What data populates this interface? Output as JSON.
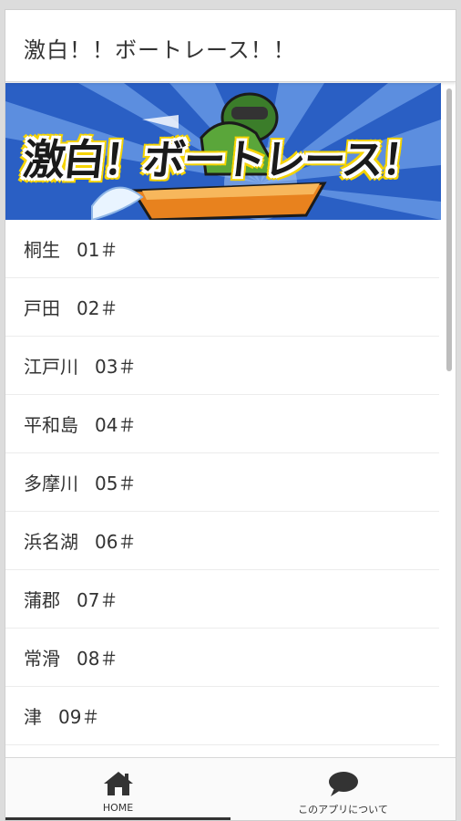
{
  "header": {
    "title": "激白！！ボートレース！！"
  },
  "banner": {
    "text": "激白！ボートレース！",
    "colors": {
      "sky": "#2a5fc4",
      "rays": "#6d9ee8",
      "outline": "#f5d300",
      "boat": "#e8821e"
    }
  },
  "venues": [
    {
      "name": "桐生",
      "code": "01＃"
    },
    {
      "name": "戸田",
      "code": "02＃"
    },
    {
      "name": "江戸川",
      "code": "03＃"
    },
    {
      "name": "平和島",
      "code": "04＃"
    },
    {
      "name": "多摩川",
      "code": "05＃"
    },
    {
      "name": "浜名湖",
      "code": "06＃"
    },
    {
      "name": "蒲郡",
      "code": "07＃"
    },
    {
      "name": "常滑",
      "code": "08＃"
    },
    {
      "name": "津",
      "code": "09＃"
    }
  ],
  "bottom_nav": {
    "home": {
      "label": "HOME",
      "icon": "home-icon"
    },
    "about": {
      "label": "このアプリについて",
      "icon": "speech-bubble-icon"
    }
  }
}
